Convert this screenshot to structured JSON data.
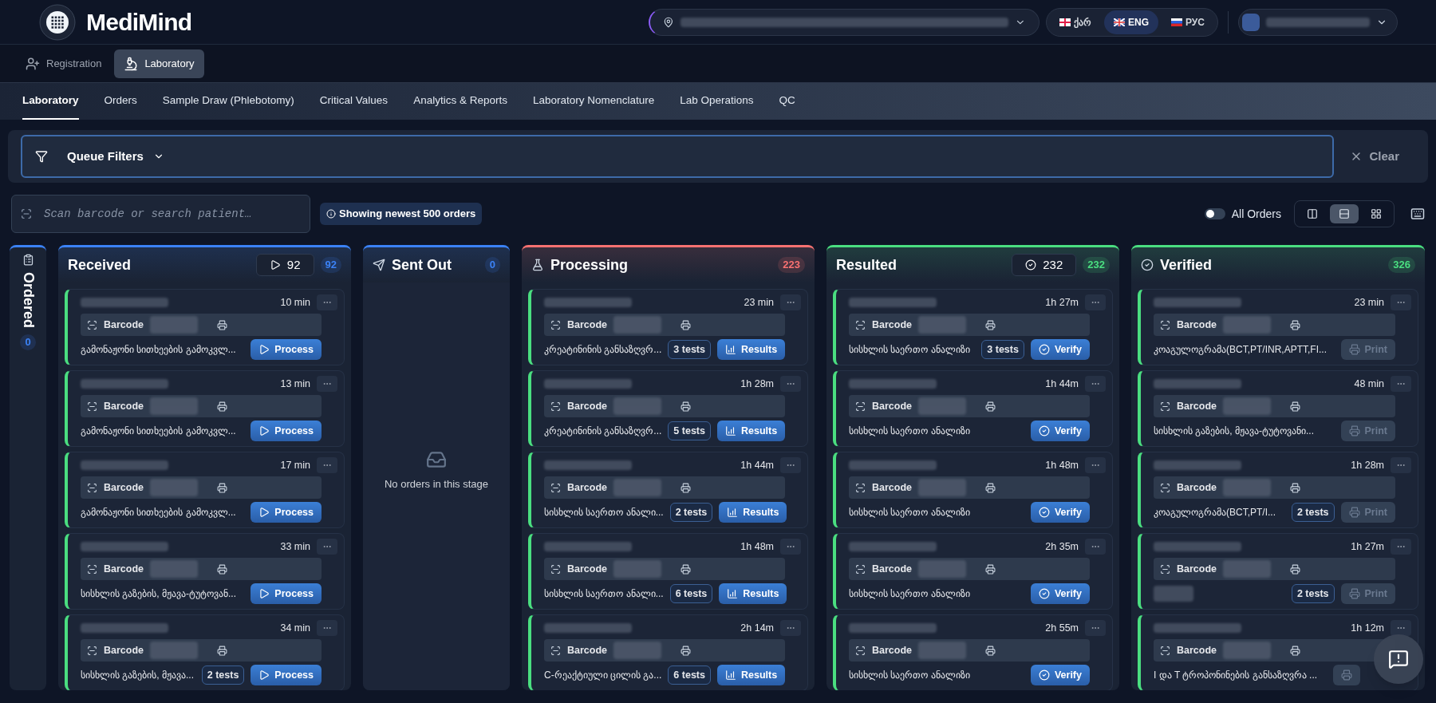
{
  "header": {
    "brand": "MediMind",
    "languages": [
      {
        "kind": "ka",
        "label": "ქარ",
        "selected": false
      },
      {
        "kind": "en",
        "label": "ENG",
        "selected": true
      },
      {
        "kind": "ru",
        "label": "РУС",
        "selected": false
      }
    ]
  },
  "modules": [
    {
      "kind": "registration",
      "label": "Registration",
      "selected": false
    },
    {
      "kind": "laboratory",
      "label": "Laboratory",
      "selected": true
    }
  ],
  "tabs": [
    {
      "label": "Laboratory",
      "selected": true
    },
    {
      "label": "Orders",
      "selected": false
    },
    {
      "label": "Sample Draw (Phlebotomy)",
      "selected": false
    },
    {
      "label": "Critical Values",
      "selected": false
    },
    {
      "label": "Analytics & Reports",
      "selected": false
    },
    {
      "label": "Laboratory Nomenclature",
      "selected": false
    },
    {
      "label": "Lab Operations",
      "selected": false
    },
    {
      "label": "QC",
      "selected": false
    }
  ],
  "filters": {
    "label": "Queue Filters",
    "clear": "Clear"
  },
  "search": {
    "placeholder": "Scan barcode or search patient…"
  },
  "notice": "Showing newest 500 orders",
  "all_orders": {
    "label": "All Orders",
    "on": false
  },
  "views": [
    {
      "kind": "kanban",
      "selected": false
    },
    {
      "kind": "list",
      "selected": true
    },
    {
      "kind": "grid",
      "selected": false
    }
  ],
  "ordered": {
    "title": "Ordered",
    "count": "0"
  },
  "columns": [
    {
      "title": "Received",
      "kind": "received",
      "color": "#3b82f6",
      "queue": {
        "count": "92"
      },
      "count": "92",
      "cards": [
        {
          "time": "10 min",
          "barcode_label": "Barcode",
          "test": "გამონაჟონი სითხეების გამოკვლ...",
          "action": {
            "kind": "process",
            "label": "Process"
          }
        },
        {
          "time": "13 min",
          "barcode_label": "Barcode",
          "test": "გამონაჟონი სითხეების გამოკვლ...",
          "action": {
            "kind": "process",
            "label": "Process"
          }
        },
        {
          "time": "17 min",
          "barcode_label": "Barcode",
          "test": "გამონაჟონი სითხეების გამოკვლ...",
          "action": {
            "kind": "process",
            "label": "Process"
          }
        },
        {
          "time": "33 min",
          "barcode_label": "Barcode",
          "test": "სისხლის გაზების, მჟავა-ტუტოვან...",
          "action": {
            "kind": "process",
            "label": "Process"
          }
        },
        {
          "time": "34 min",
          "barcode_label": "Barcode",
          "test": "სისხლის გაზების, მჟავა...",
          "tests": "2 tests",
          "action": {
            "kind": "process",
            "label": "Process"
          }
        }
      ]
    },
    {
      "title": "Sent Out",
      "kind": "sent_out",
      "color": "#3b82f6",
      "count": "0",
      "empty": "No orders in this stage"
    },
    {
      "title": "Processing",
      "kind": "processing",
      "color": "#f87171",
      "count": "223",
      "cards": [
        {
          "time": "23 min",
          "barcode_label": "Barcode",
          "test": "კრეატინინის განსაზღვრ...",
          "tests": "3 tests",
          "action": {
            "kind": "results",
            "label": "Results"
          }
        },
        {
          "time": "1h 28m",
          "barcode_label": "Barcode",
          "test": "კრეატინინის განსაზღვრ...",
          "tests": "5 tests",
          "action": {
            "kind": "results",
            "label": "Results"
          }
        },
        {
          "time": "1h 44m",
          "barcode_label": "Barcode",
          "test": "სისხლის საერთო ანალი...",
          "tests": "2 tests",
          "action": {
            "kind": "results",
            "label": "Results"
          }
        },
        {
          "time": "1h 48m",
          "barcode_label": "Barcode",
          "test": "სისხლის საერთო ანალი...",
          "tests": "6 tests",
          "action": {
            "kind": "results",
            "label": "Results"
          }
        },
        {
          "time": "2h 14m",
          "barcode_label": "Barcode",
          "test": "C-რეაქტიული ცილის გა...",
          "tests": "6 tests",
          "action": {
            "kind": "results",
            "label": "Results"
          }
        }
      ]
    },
    {
      "title": "Resulted",
      "kind": "resulted",
      "color": "#4ade80",
      "queue": {
        "count": "232"
      },
      "count": "232",
      "cards": [
        {
          "time": "1h 27m",
          "barcode_label": "Barcode",
          "test": "სისხლის საერთო ანალიზი",
          "tests": "3 tests",
          "action": {
            "kind": "verify",
            "label": "Verify"
          }
        },
        {
          "time": "1h 44m",
          "barcode_label": "Barcode",
          "test": "სისხლის საერთო ანალიზი",
          "action": {
            "kind": "verify",
            "label": "Verify"
          }
        },
        {
          "time": "1h 48m",
          "barcode_label": "Barcode",
          "test": "სისხლის საერთო ანალიზი",
          "action": {
            "kind": "verify",
            "label": "Verify"
          }
        },
        {
          "time": "2h 35m",
          "barcode_label": "Barcode",
          "test": "სისხლის საერთო ანალიზი",
          "action": {
            "kind": "verify",
            "label": "Verify"
          }
        },
        {
          "time": "2h 55m",
          "barcode_label": "Barcode",
          "test": "სისხლის საერთო ანალიზი",
          "action": {
            "kind": "verify",
            "label": "Verify"
          }
        }
      ]
    },
    {
      "title": "Verified",
      "kind": "verified",
      "color": "#4ade80",
      "count": "326",
      "cards": [
        {
          "time": "23 min",
          "barcode_label": "Barcode",
          "test": "კოაგულოგრამა(BCT,PT/INR,APTT,FI...",
          "action": {
            "kind": "print",
            "label": "Print"
          }
        },
        {
          "time": "48 min",
          "barcode_label": "Barcode",
          "test": "სისხლის გაზების, მჟავა-ტუტოვანი...",
          "action": {
            "kind": "print",
            "label": "Print"
          }
        },
        {
          "time": "1h 28m",
          "barcode_label": "Barcode",
          "test": "კოაგულოგრამა(BCT,PT/I...",
          "tests": "2 tests",
          "action": {
            "kind": "print",
            "label": "Print"
          }
        },
        {
          "time": "1h 27m",
          "barcode_label": "Barcode",
          "tests": "2 tests",
          "action": {
            "kind": "print",
            "label": "Print"
          }
        },
        {
          "time": "1h 12m",
          "barcode_label": "Barcode",
          "test": "I და T ტროპონინების განსაზღვრა ...",
          "action": {
            "kind": "print"
          }
        }
      ]
    }
  ]
}
